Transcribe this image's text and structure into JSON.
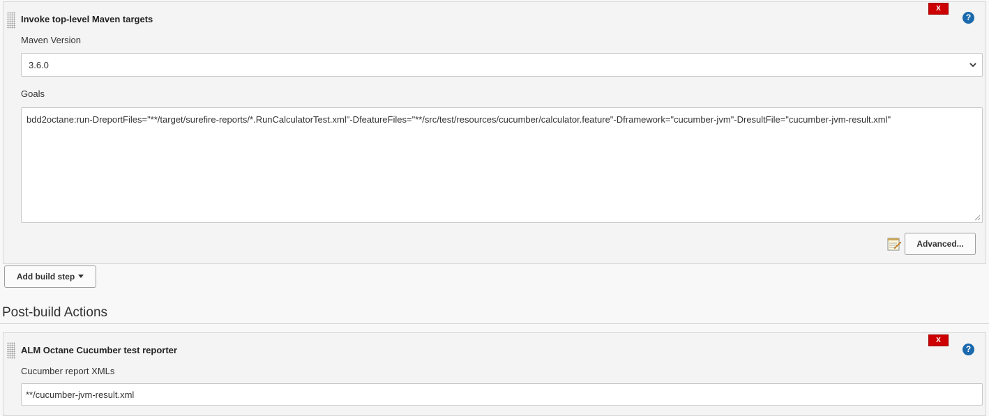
{
  "build_step": {
    "title": "Invoke top-level Maven targets",
    "delete_label": "X",
    "help_label": "?",
    "maven_version_label": "Maven Version",
    "maven_version_value": "3.6.0",
    "goals_label": "Goals",
    "goals_value": "bdd2octane:run-DreportFiles=\"**/target/surefire-reports/*.RunCalculatorTest.xml\"-DfeatureFiles=\"**/src/test/resources/cucumber/calculator.feature\"-Dframework=\"cucumber-jvm\"-DresultFile=\"cucumber-jvm-result.xml\"",
    "advanced_label": "Advanced..."
  },
  "add_build_step_label": "Add build step",
  "post_build": {
    "heading": "Post-build Actions",
    "reporter": {
      "title": "ALM Octane Cucumber test reporter",
      "delete_label": "X",
      "help_label": "?",
      "xml_label": "Cucumber report XMLs",
      "xml_value": "**/cucumber-jvm-result.xml"
    }
  },
  "icons": {
    "drag_handle": "drag-handle-icon",
    "help": "help-icon",
    "delete": "delete-icon",
    "chevron": "chevron-down-icon",
    "notepad": "notepad-edit-icon",
    "caret": "caret-down-icon"
  },
  "colors": {
    "delete_red": "#cc0000",
    "help_blue": "#1a69ad"
  }
}
